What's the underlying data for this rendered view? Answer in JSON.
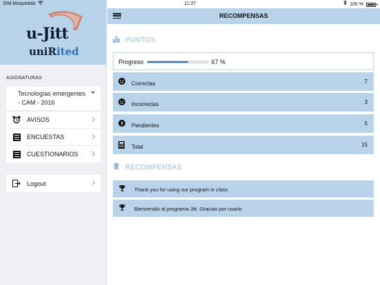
{
  "status_bar": {
    "carrier": "SIM bloqueada",
    "time": "11:37",
    "battery": "100 %"
  },
  "sidebar": {
    "logo_line1": "u-Jitt",
    "logo_line2a": "uniR",
    "logo_line2b": "ited",
    "section_title": "ASIGNATURAS",
    "course_select": "Tecnologías emergentes - CAM - 2016",
    "items": [
      {
        "label": "AVISOS",
        "icon": "alarm-clock-icon"
      },
      {
        "label": "ENCUESTAS",
        "icon": "list-icon"
      },
      {
        "label": "CUESTIONARIOS",
        "icon": "list-icon"
      }
    ],
    "logout_label": "Logout"
  },
  "navbar": {
    "title": "RECOMPENSAS"
  },
  "puntos": {
    "header": "PUNTOS",
    "progress_label": "Progreso",
    "progress_value": 0.67,
    "progress_text": "67 %",
    "rows": [
      {
        "label": "Correctas",
        "value": "7",
        "icon": "smile-icon"
      },
      {
        "label": "Incorrectas",
        "value": "3",
        "icon": "frown-icon"
      },
      {
        "label": "Pendientes",
        "value": "5",
        "icon": "question-icon"
      },
      {
        "label": "Total",
        "value": "15",
        "icon": "calculator-icon"
      }
    ]
  },
  "recompensas": {
    "header": "RECOMPENSAS",
    "items": [
      {
        "text": "Thank you for using our program in class",
        "icon": "trophy-icon"
      },
      {
        "text": "Bienvenido al programa Jitt. Gracias por usarlo",
        "icon": "trophy-icon"
      }
    ]
  },
  "colors": {
    "accent": "#b9d3ea",
    "progress": "#2f6fd6",
    "header_text": "#9db9d8"
  }
}
